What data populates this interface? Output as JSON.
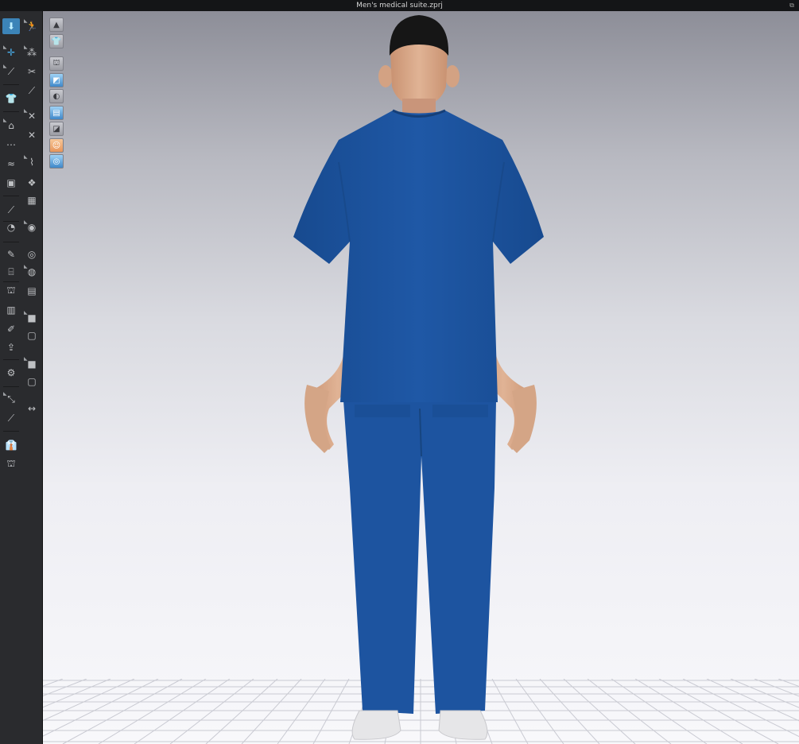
{
  "window": {
    "title": "Men's medical suite.zprj",
    "float_icon": "float-window-icon"
  },
  "toolbar": {
    "left_column": [
      {
        "id": "select-mesh",
        "icon": "move-arrow-icon",
        "active": true
      },
      {
        "id": "transform",
        "icon": "transform-icon"
      },
      {
        "id": "edit-garment",
        "icon": "wand-icon"
      },
      {
        "id": "simulation",
        "icon": "shirt-sim-icon"
      },
      {
        "id": "pin",
        "icon": "pin-icon"
      },
      {
        "id": "fold",
        "icon": "fold-icon"
      },
      {
        "id": "steam",
        "icon": "steam-icon"
      },
      {
        "id": "camera",
        "icon": "camera-icon"
      },
      {
        "id": "tape",
        "icon": "tape-icon"
      },
      {
        "id": "seam",
        "icon": "seam-icon"
      },
      {
        "id": "brush",
        "icon": "brush-icon"
      },
      {
        "id": "sewing",
        "icon": "sewing-icon"
      },
      {
        "id": "garment-front",
        "icon": "garment-icon"
      },
      {
        "id": "book",
        "icon": "book-icon"
      },
      {
        "id": "pen",
        "icon": "pen-icon"
      },
      {
        "id": "avatar-arrow",
        "icon": "avatar-arrow-icon"
      },
      {
        "id": "measure",
        "icon": "measure-icon"
      },
      {
        "id": "ruler",
        "icon": "ruler-icon"
      },
      {
        "id": "needle",
        "icon": "needle-icon"
      },
      {
        "id": "shirt-a",
        "icon": "shirt-icon"
      },
      {
        "id": "shirt-b",
        "icon": "shirt-outline-icon"
      }
    ],
    "right_column": [
      {
        "id": "pose",
        "icon": "pose-icon"
      },
      {
        "id": "select-points",
        "icon": "points-icon"
      },
      {
        "id": "edit-pattern",
        "icon": "pattern-edit-icon"
      },
      {
        "id": "tack",
        "icon": "tack-icon"
      },
      {
        "id": "strap",
        "icon": "strap-icon"
      },
      {
        "id": "fit",
        "icon": "fit-icon"
      },
      {
        "id": "zipper",
        "icon": "zipper-icon"
      },
      {
        "id": "texture",
        "icon": "texture-icon"
      },
      {
        "id": "button-a",
        "icon": "button-icon"
      },
      {
        "id": "button-b",
        "icon": "button-lock-icon"
      },
      {
        "id": "grid",
        "icon": "grid-icon"
      },
      {
        "id": "scale",
        "icon": "scale-icon"
      },
      {
        "id": "fabric-a",
        "icon": "fabric-swatch-icon"
      },
      {
        "id": "fabric-b",
        "icon": "fabric-square-icon"
      },
      {
        "id": "fabric-c",
        "icon": "fabric-small-icon"
      },
      {
        "id": "fabric-d",
        "icon": "fabric-block-icon"
      },
      {
        "id": "arrows",
        "icon": "split-arrows-icon"
      }
    ]
  },
  "viewport_tools": [
    {
      "id": "display-mode",
      "icon": "stand-icon"
    },
    {
      "id": "garment-display",
      "icon": "garment-gray-icon"
    },
    {
      "id": "show-garment",
      "icon": "shirt-eye-icon"
    },
    {
      "id": "show-pattern",
      "icon": "pattern-eye-icon"
    },
    {
      "id": "show-avatar",
      "icon": "avatar-eye-icon"
    },
    {
      "id": "show-fabric",
      "icon": "fabric-blue-icon"
    },
    {
      "id": "show-shadow",
      "icon": "shadow-icon"
    },
    {
      "id": "skin",
      "icon": "skin-avatar-icon"
    },
    {
      "id": "environment",
      "icon": "globe-icon"
    }
  ],
  "scene": {
    "garment_color": "#1d54a0",
    "skin_color": "#d8a985",
    "hair_color": "#1a1a1a",
    "shoe_color": "#e6e6e8"
  }
}
